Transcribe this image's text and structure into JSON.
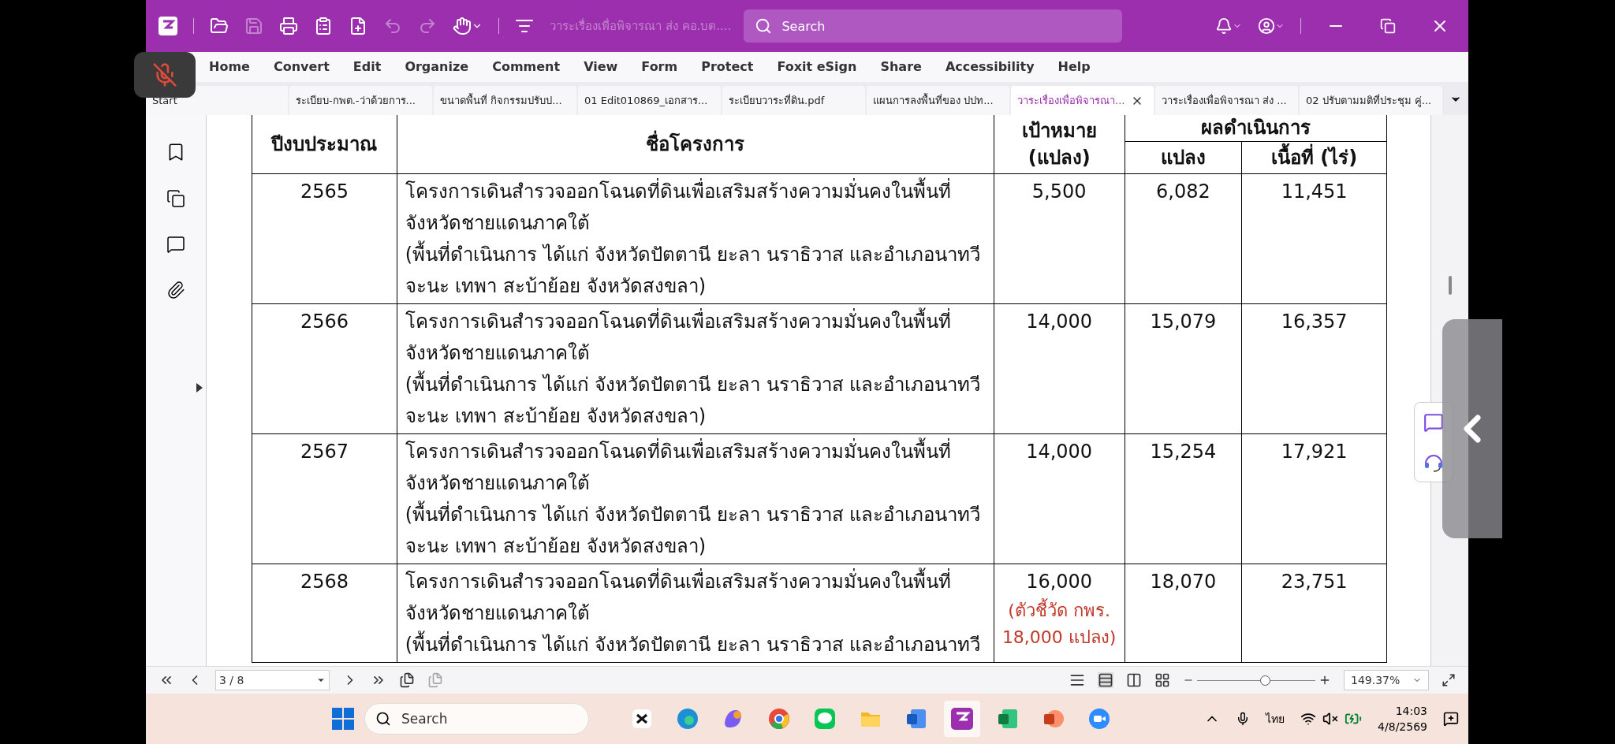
{
  "title_bar": {
    "document_title": "วาระเรื่องเพื่อพิจารณา ส่ง คอ.บต....",
    "search": {
      "placeholder": "Search"
    }
  },
  "menu": [
    "Home",
    "Convert",
    "Edit",
    "Organize",
    "Comment",
    "View",
    "Form",
    "Protect",
    "Foxit eSign",
    "Share",
    "Accessibility",
    "Help"
  ],
  "tabs": [
    {
      "label": "Start",
      "selected": false
    },
    {
      "label": "ระเบียบ-กพต.-ว่าด้วยการ...",
      "selected": false
    },
    {
      "label": "ขนาดพื้นที่ กิจกรรมปรับป...",
      "selected": false
    },
    {
      "label": "01 Edit010869_เอกสาร...",
      "selected": false
    },
    {
      "label": "ระเบียบวาระที่ดิน.pdf",
      "selected": false
    },
    {
      "label": "แผนการลงพื้นที่ของ ปปท...",
      "selected": false
    },
    {
      "label": "วาระเรื่องเพื่อพิจารณา...",
      "selected": true
    },
    {
      "label": "วาระเรื่องเพื่อพิจารณา ส่ง ...",
      "selected": false
    },
    {
      "label": "02 ปรับตามมติที่ประชุม คู่...",
      "selected": false
    }
  ],
  "table": {
    "headers": {
      "year": "ปีงบประมาณ",
      "project": "ชื่อโครงการ",
      "target": "เป้าหมาย",
      "target_unit": "(แปลง)",
      "result": "ผลดำเนินการ",
      "result_plots": "แปลง",
      "result_area": "เนื้อที่ (ไร่)"
    },
    "rows": [
      {
        "year": "2565",
        "project_lines": [
          "โครงการเดินสำรวจออกโฉนดที่ดินเพื่อเสริมสร้างความมั่นคงในพื้นที่",
          "จังหวัดชายแดนภาคใต้",
          "(พื้นที่ดำเนินการ ได้แก่ จังหวัดปัตตานี ยะลา นราธิวาส และอำเภอนาทวี",
          "จะนะ เทพา สะบ้าย้อย จังหวัดสงขลา)"
        ],
        "target": "5,500",
        "plots": "6,082",
        "area": "11,451"
      },
      {
        "year": "2566",
        "project_lines": [
          "โครงการเดินสำรวจออกโฉนดที่ดินเพื่อเสริมสร้างความมั่นคงในพื้นที่",
          "จังหวัดชายแดนภาคใต้",
          "(พื้นที่ดำเนินการ ได้แก่ จังหวัดปัตตานี ยะลา นราธิวาส และอำเภอนาทวี",
          "จะนะ เทพา สะบ้าย้อย จังหวัดสงขลา)"
        ],
        "target": "14,000",
        "plots": "15,079",
        "area": "16,357"
      },
      {
        "year": "2567",
        "project_lines": [
          "โครงการเดินสำรวจออกโฉนดที่ดินเพื่อเสริมสร้างความมั่นคงในพื้นที่",
          "จังหวัดชายแดนภาคใต้",
          "(พื้นที่ดำเนินการ ได้แก่ จังหวัดปัตตานี ยะลา นราธิวาส และอำเภอนาทวี",
          "จะนะ เทพา สะบ้าย้อย จังหวัดสงขลา)"
        ],
        "target": "14,000",
        "plots": "15,254",
        "area": "17,921"
      },
      {
        "year": "2568",
        "project_lines": [
          "โครงการเดินสำรวจออกโฉนดที่ดินเพื่อเสริมสร้างความมั่นคงในพื้นที่",
          "จังหวัดชายแดนภาคใต้",
          "(พื้นที่ดำเนินการ ได้แก่ จังหวัดปัตตานี ยะลา นราธิวาส และอำเภอนาทวี"
        ],
        "target": "16,000",
        "target_note": "(ตัวชี้วัด กพร. 18,000 แปลง)",
        "plots": "18,070",
        "area": "23,751"
      }
    ]
  },
  "status_bar": {
    "page": "3 / 8",
    "zoom": "149.37%",
    "zoom_slider": {
      "level": 0.57
    }
  },
  "taskbar": {
    "search": {
      "placeholder": "Search"
    },
    "apps": [
      {
        "kind": "capcut",
        "active": false
      },
      {
        "kind": "edge",
        "active": false
      },
      {
        "kind": "copilot",
        "active": false
      },
      {
        "kind": "chrome",
        "active": false
      },
      {
        "kind": "line",
        "active": false
      },
      {
        "kind": "folder",
        "active": false
      },
      {
        "kind": "word",
        "active": false
      },
      {
        "kind": "editor",
        "active": true
      },
      {
        "kind": "excel",
        "active": false
      },
      {
        "kind": "powerpoint",
        "active": false
      },
      {
        "kind": "zoom",
        "active": false
      }
    ],
    "language": "ไทย",
    "time": "14:03",
    "date": "4/8/2569"
  }
}
